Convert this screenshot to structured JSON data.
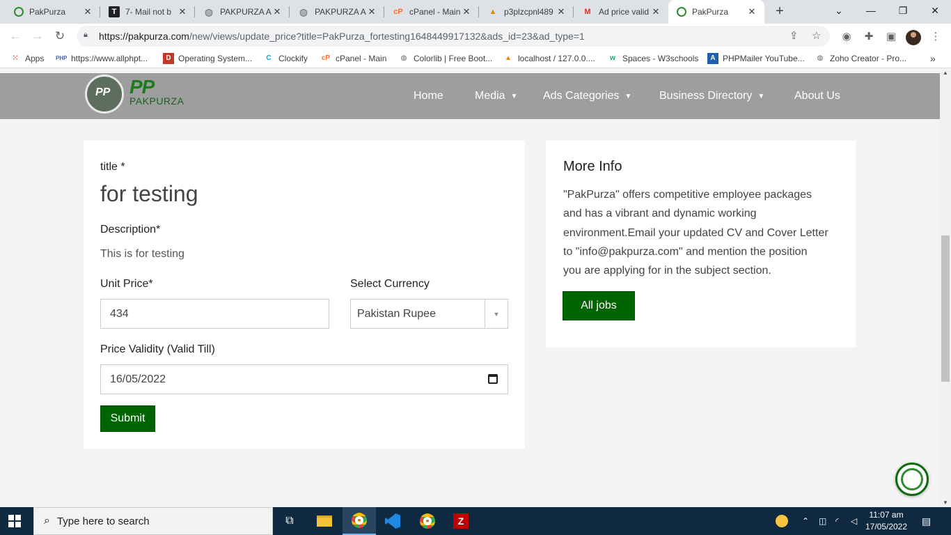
{
  "browser": {
    "tabs": [
      {
        "title": "PakPurza",
        "icon": "pakpurza-icon",
        "active": false
      },
      {
        "title": "7- Mail not b",
        "icon": "trello-icon",
        "active": false
      },
      {
        "title": "PAKPURZA A",
        "icon": "globe-icon",
        "active": false
      },
      {
        "title": "PAKPURZA A",
        "icon": "globe-icon",
        "active": false
      },
      {
        "title": "cPanel - Main",
        "icon": "cpanel-icon",
        "active": false
      },
      {
        "title": "p3plzcpnl489",
        "icon": "phpmyadmin-icon",
        "active": false
      },
      {
        "title": "Ad price valid",
        "icon": "gmail-icon",
        "active": false
      },
      {
        "title": "PakPurza",
        "icon": "pakpurza-icon",
        "active": true
      }
    ],
    "url_domain": "https://pakpurza.com",
    "url_path": "/new/views/update_price?title=PakPurza_fortesting1648449917132&ads_id=23&ad_type=1",
    "bookmarks": [
      {
        "label": "Apps",
        "icon": "apps-grid-icon"
      },
      {
        "label": "https://www.allphpt...",
        "icon": "php-icon"
      },
      {
        "label": "Operating System...",
        "icon": "td-icon"
      },
      {
        "label": "Clockify",
        "icon": "clockify-icon"
      },
      {
        "label": "cPanel - Main",
        "icon": "cpanel-icon"
      },
      {
        "label": "Colorlib | Free Boot...",
        "icon": "globe-icon"
      },
      {
        "label": "localhost / 127.0.0....",
        "icon": "phpmyadmin-icon"
      },
      {
        "label": "Spaces - W3schools",
        "icon": "w3schools-icon"
      },
      {
        "label": "PHPMailer YouTube...",
        "icon": "phpmailer-icon"
      },
      {
        "label": "Zoho Creator - Pro...",
        "icon": "globe-icon"
      }
    ]
  },
  "site": {
    "logo_text": "PAKPURZA",
    "logo_mark": "PP",
    "nav": [
      {
        "label": "Home",
        "dropdown": false
      },
      {
        "label": "Media",
        "dropdown": true
      },
      {
        "label": "Ads Categories",
        "dropdown": true
      },
      {
        "label": "Business Directory",
        "dropdown": true
      },
      {
        "label": "About Us",
        "dropdown": false
      }
    ]
  },
  "form": {
    "title_label": "title *",
    "title_value": "for testing",
    "description_label": "Description*",
    "description_value": "This is for testing",
    "unit_price_label": "Unit Price*",
    "unit_price_value": "434",
    "currency_label": "Select Currency",
    "currency_value": "Pakistan Rupee",
    "validity_label": "Price Validity (Valid Till)",
    "validity_value": "16/05/2022",
    "submit_label": "Submit"
  },
  "info": {
    "heading": "More Info",
    "lines": [
      "\"PakPurza\" offers competitive employee packages",
      "and has a vibrant and dynamic working",
      "environment.Email your updated CV and Cover Letter",
      "to \"info@pakpurza.com\" and mention the position",
      "you are applying for in the subject section."
    ],
    "button_label": "All jobs"
  },
  "taskbar": {
    "search_placeholder": "Type here to search",
    "time": "11:07 am",
    "date": "17/05/2022"
  },
  "colors": {
    "brand_green": "#006400",
    "header_gray": "#9e9e9e",
    "page_bg": "#f4f4f4"
  }
}
